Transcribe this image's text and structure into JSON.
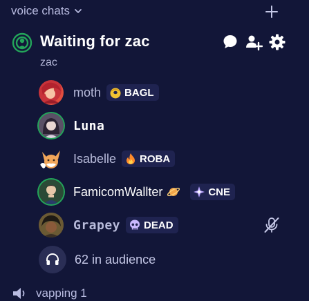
{
  "category": {
    "title": "voice chats"
  },
  "channel": {
    "name": "Waiting for zac",
    "subtitle": "zac"
  },
  "members": [
    {
      "name": "moth",
      "tag": "BAGL",
      "tag_icon": "bagel-icon"
    },
    {
      "name": "Luna"
    },
    {
      "name": "Isabelle",
      "tag": "ROBA",
      "tag_icon": "flame-icon"
    },
    {
      "name": "FamicomWallter",
      "tag": "CNE",
      "tag_icon": "diamond-sparkle-icon",
      "extra_icon": "planet-icon"
    },
    {
      "name": "Grapey",
      "tag": "DEAD",
      "tag_icon": "skull-icon",
      "muted": true
    }
  ],
  "audience": {
    "label": "62 in audience"
  },
  "next_category": {
    "title": "vapping 1"
  },
  "colors": {
    "background": "#121638",
    "speaking_ring": "#23a55a",
    "badge_bg": "#1f2350"
  }
}
